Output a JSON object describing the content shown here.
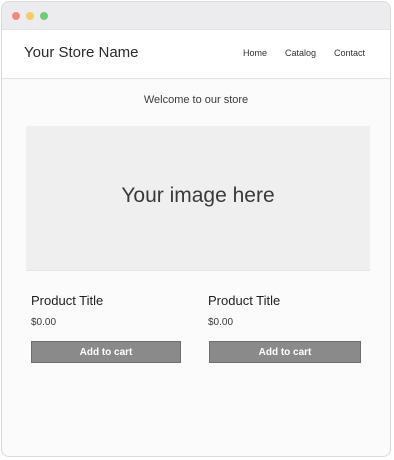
{
  "header": {
    "store_name": "Your Store Name",
    "nav": [
      {
        "label": "Home"
      },
      {
        "label": "Catalog"
      },
      {
        "label": "Contact"
      }
    ]
  },
  "main": {
    "welcome": "Welcome to our store",
    "hero_text": "Your image here",
    "products": [
      {
        "title": "Product Title",
        "price": "$0.00",
        "button_label": "Add to cart"
      },
      {
        "title": "Product Title",
        "price": "$0.00",
        "button_label": "Add to cart"
      }
    ]
  },
  "colors": {
    "button": "#8a8a8c",
    "hero_background": "#efefef",
    "window_close": "#f4897b",
    "window_minimize": "#f6cd63",
    "window_maximize": "#6dcf74"
  }
}
